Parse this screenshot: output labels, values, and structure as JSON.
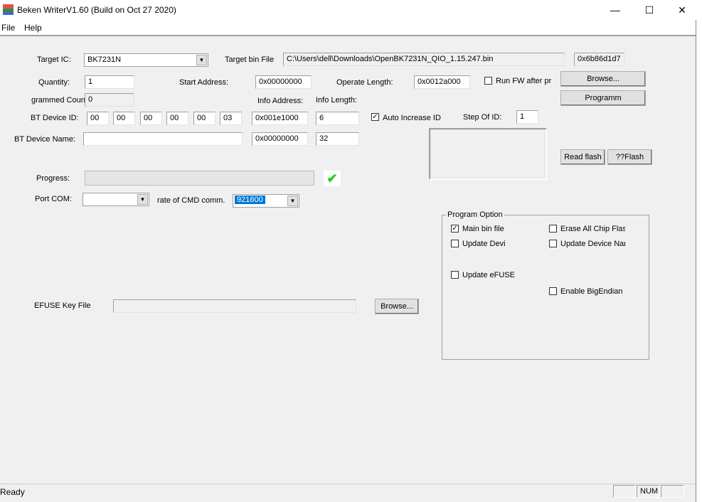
{
  "window": {
    "title": "Beken WriterV1.60 (Build on Oct 27 2020)"
  },
  "menu": [
    "File",
    "Help"
  ],
  "form": {
    "target_ic_label": "Target IC:",
    "target_ic": "BK7231N",
    "target_bin_label": "Target bin File",
    "target_bin": "C:\\Users\\dell\\Downloads\\OpenBK7231N_QIO_1.15.247.bin",
    "checksum": "0x6b86d1d7",
    "quantity_label": "Quantity:",
    "quantity": "1",
    "start_address_label": "Start Address:",
    "start_address": "0x00000000",
    "operate_length_label": "Operate Length:",
    "operate_length": "0x0012a000",
    "run_fw_label": "Run FW after pr",
    "programmed_count_label": "grammed Coun",
    "programmed_count": "0",
    "info_address_label": "Info Address:",
    "info_length_label": "Info Length:",
    "bt_device_id_label": "BT Device ID:",
    "bt_device_id": [
      "00",
      "00",
      "00",
      "00",
      "00",
      "03"
    ],
    "bt_info_address": "0x001e1000",
    "bt_info_length": "6",
    "auto_increase_label": "Auto Increase ID",
    "step_of_id_label": "Step Of ID:",
    "step_of_id": "1",
    "bt_device_name_label": "BT Device Name:",
    "bt_device_name": "",
    "name_info_address": "0x00000000",
    "name_info_length": "32",
    "progress_label": "Progress:",
    "progress": 0,
    "port_com_label": "Port COM:",
    "port_com": "",
    "baud_label": "rate of CMD comm.",
    "baud": "921600",
    "efuse_label": "EFUSE Key File",
    "efuse_file": ""
  },
  "buttons": {
    "browse": "Browse...",
    "program": "Programm",
    "read_flash": "Read flash",
    "flash": "??Flash",
    "efuse_browse": "Browse..."
  },
  "program_option": {
    "title": "Program Option",
    "items": [
      {
        "label": "Main bin file",
        "checked": true
      },
      {
        "label": "Erase All Chip Flash",
        "checked": false
      },
      {
        "label": "Update Devi",
        "checked": false
      },
      {
        "label": "Update Device Nan",
        "checked": false
      },
      {
        "label": "Update eFUSE",
        "checked": false
      },
      {
        "label": "Enable BigEndian II",
        "checked": false
      }
    ]
  },
  "status": {
    "text": "Ready",
    "num": "NUM"
  }
}
